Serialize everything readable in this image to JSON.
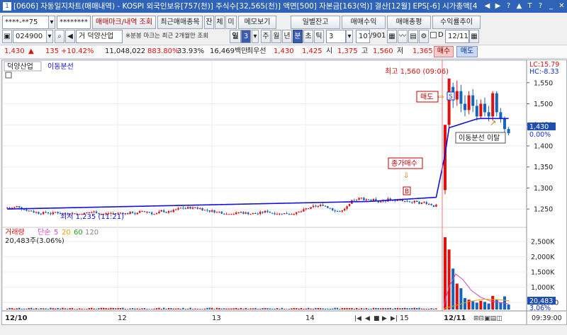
{
  "window": {
    "title": "[0606] 자동일지차트(매매내역) - KOSPI 외국인보유[757(천)] 주식수[32,565(천)] 액면[500] 자본금[163(억)] 결산[12월] EPS[-6] 시가총액[4",
    "ctrl_icons": [
      "◀",
      "▶",
      "?",
      "▲",
      "T",
      "?",
      "_",
      "✕"
    ]
  },
  "toolbar": {
    "account_number": "****-**75",
    "password": "********",
    "buttons": [
      "매매마크/내역 조회",
      "최근매매종목",
      "잔",
      "체",
      "미",
      "메모보기"
    ],
    "right_buttons": [
      "일별잔고",
      "매매수익",
      "매매총평",
      "수익률추이"
    ]
  },
  "stock_bar": {
    "code": "024900",
    "flag": "거",
    "name": "덕양산업",
    "note": "※분봉 마크는 최근 2개월만 조회",
    "period_value": "3",
    "periods": [
      "주",
      "월",
      "년",
      "분",
      "초",
      "틱"
    ],
    "period_selected": "분",
    "tick_value": "3",
    "count": "107",
    "total": "/901",
    "date": "12/11"
  },
  "quote": {
    "price": "1,430",
    "change_mark": "▲",
    "change": "135",
    "change_pct": "+10.42%",
    "volume": "11,048,022",
    "vol_ratio": "883.80%",
    "turnover": "33.93%",
    "amount": "16,469백만",
    "best_ask_label": "최우선",
    "ask": "1,430",
    "bid": "1,425",
    "open_label": "시",
    "open": "1,375",
    "high_label": "고",
    "high": "1,560",
    "low_label": "저",
    "low": "1,365",
    "buy_btn": "매수",
    "sell_btn": "매도"
  },
  "chart": {
    "stock_label": "덕양산업",
    "ma_label": "이동분선",
    "lc_label": "LC:15.79",
    "hc_label": "HC:-8.33",
    "high_marker": "최고 1,560 (09:06)",
    "low_marker": "최저 1,235 (11:21)",
    "sell_callout": "매도",
    "sell_mark": "S",
    "buy_callout": "종가매수",
    "buy_mark": "B",
    "ma_break_callout": "이동분선 이탈",
    "price_axis": [
      "1,550",
      "1,500",
      "1,450",
      "1,400",
      "1,350",
      "1,300",
      "1,250"
    ],
    "current_price_tag": "1,430",
    "current_pct_tag": "0.00%",
    "volume_legend": {
      "name": "거래량",
      "ma_label": "단순",
      "ma1": "5",
      "ma2": "20",
      "ma3": "60",
      "ma4": "120",
      "value": "20,483주(3.06%)"
    },
    "volume_axis": [
      "2,500K",
      "2,000K",
      "1,500K",
      "1,000K",
      "500,000"
    ],
    "volume_tag": "20,483",
    "volume_pct_tag": "3.06%",
    "x_axis": [
      "12/10",
      "12",
      "13",
      "14",
      "15",
      "12/11"
    ],
    "time_label": "09:39:00",
    "colors": {
      "up": "#e01010",
      "down": "#1565c0",
      "ma": "#1010e0",
      "cursor": "#ff6060"
    }
  },
  "chart_data": {
    "type": "candlestick",
    "candles_price_summary": {
      "open": 1375,
      "high": 1560,
      "low": 1365,
      "close": 1430
    },
    "prev_close_approx": 1295,
    "ylim": [
      1220,
      1590
    ],
    "volume_ylim": [
      0,
      2700000
    ]
  }
}
